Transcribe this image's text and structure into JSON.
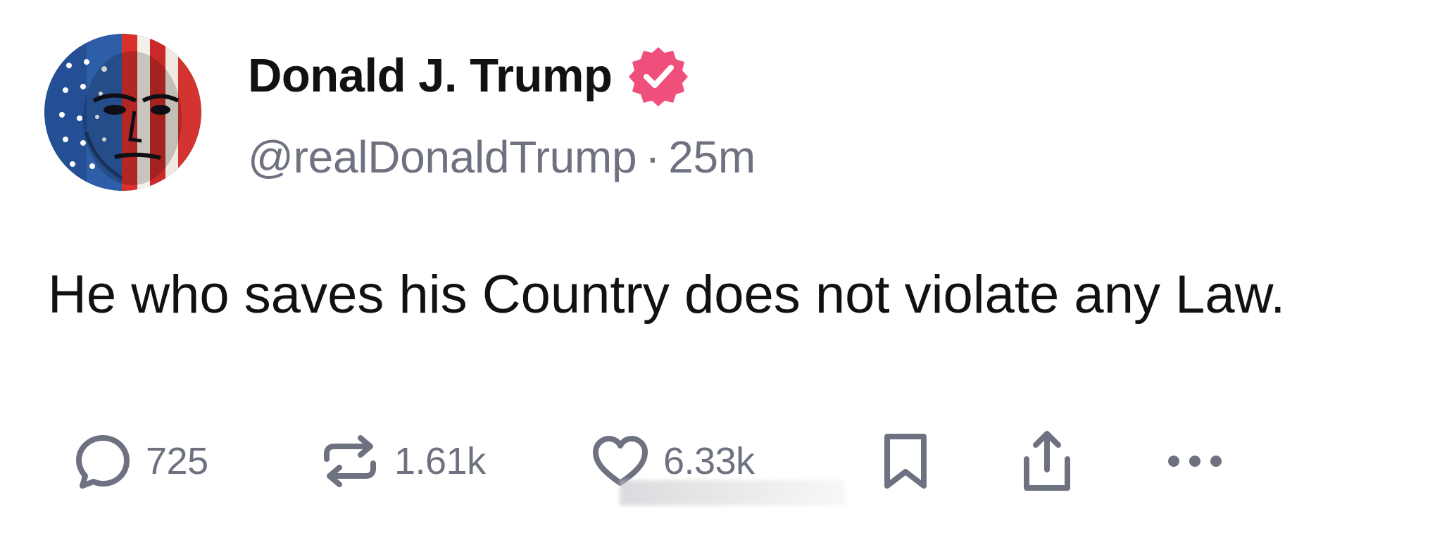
{
  "author": {
    "display_name": "Donald J. Trump",
    "handle": "@realDonaldTrump",
    "separator": "·",
    "time_ago": "25m",
    "verified": true,
    "verified_badge_color": "#ef4f7b",
    "avatar": "flag-painted-face-portrait"
  },
  "post": {
    "text": "He who saves his Country does not violate any Law."
  },
  "actions": {
    "reply_count": "725",
    "repost_count": "1.61k",
    "like_count": "6.33k",
    "icons": [
      "reply-icon",
      "repost-icon",
      "like-icon",
      "bookmark-icon",
      "share-icon",
      "more-icon"
    ]
  },
  "colors": {
    "text": "#111111",
    "muted": "#6e7180",
    "background": "#ffffff"
  }
}
